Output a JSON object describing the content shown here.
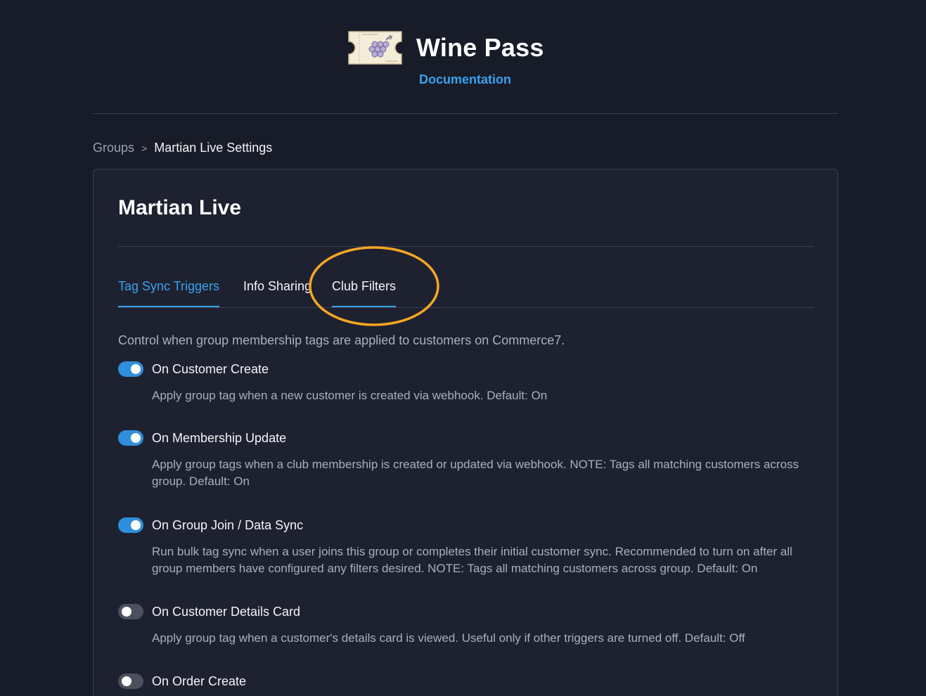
{
  "header": {
    "app_title": "Wine Pass",
    "documentation_link": "Documentation"
  },
  "breadcrumb": {
    "parent": "Groups",
    "separator": ">",
    "current": "Martian Live Settings"
  },
  "card": {
    "title": "Martian Live",
    "tabs": [
      {
        "label": "Tag Sync Triggers",
        "active": true
      },
      {
        "label": "Info Sharing",
        "active": false
      },
      {
        "label": "Club Filters",
        "active": false
      }
    ],
    "intro": "Control when group membership tags are applied to customers on Commerce7.",
    "settings": [
      {
        "label": "On Customer Create",
        "enabled": true,
        "description": "Apply group tag when a new customer is created via webhook. Default: On"
      },
      {
        "label": "On Membership Update",
        "enabled": true,
        "description": "Apply group tags when a club membership is created or updated via webhook. NOTE: Tags all matching customers across group. Default: On"
      },
      {
        "label": "On Group Join / Data Sync",
        "enabled": true,
        "description": "Run bulk tag sync when a user joins this group or completes their initial customer sync. Recommended to turn on after all group members have configured any filters desired. NOTE: Tags all matching customers across group. Default: On"
      },
      {
        "label": "On Customer Details Card",
        "enabled": false,
        "description": "Apply group tag when a customer's details card is viewed. Useful only if other triggers are turned off. Default: Off"
      },
      {
        "label": "On Order Create",
        "enabled": false,
        "description": ""
      }
    ]
  },
  "colors": {
    "background": "#171c28",
    "card": "#1e2230",
    "accent": "#3aa2f0",
    "toggle_on": "#2f8fdc",
    "toggle_off": "#4a505d",
    "highlight": "#f5a623"
  },
  "icons": {
    "logo": "wine-ticket-grapes-icon"
  }
}
